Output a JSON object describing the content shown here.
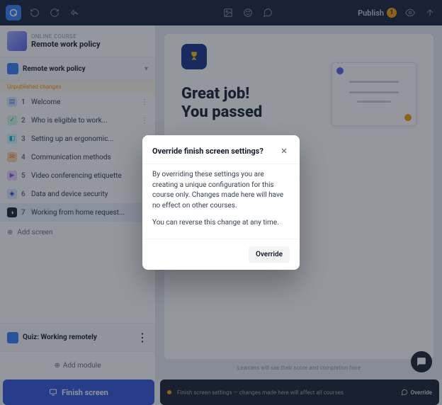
{
  "topbar": {
    "publish_label": "Publish",
    "publish_badge": "1"
  },
  "crumb": {
    "category": "ONLINE COURSE",
    "title": "Remote work policy"
  },
  "section": {
    "title": "Remote work policy",
    "unpublished_label": "Unpublished changes"
  },
  "items": [
    {
      "num": "1",
      "label": "Welcome"
    },
    {
      "num": "2",
      "label": "Who is eligible to work..."
    },
    {
      "num": "3",
      "label": "Setting up an ergonomic..."
    },
    {
      "num": "4",
      "label": "Communication methods"
    },
    {
      "num": "5",
      "label": "Video conferencing etiquette"
    },
    {
      "num": "6",
      "label": "Data and device security"
    },
    {
      "num": "7",
      "label": "Working from home request..."
    }
  ],
  "add_screen": "Add screen",
  "quiz": {
    "label": "Quiz: Working remotely"
  },
  "add_module": "Add module",
  "preview": {
    "line1": "Great job!",
    "line2": "You passed"
  },
  "footer_note": "Learners will see their score and completion here",
  "finish_button": "Finish screen",
  "settings_note": "Finish screen settings — changes made here will affect all courses",
  "override_link": "Override",
  "modal": {
    "title": "Override finish screen settings?",
    "p1": "By overriding these settings you are creating a unique configuration for this course only. Changes made here will have no effect on other courses.",
    "p2": "You can reverse this change at any time.",
    "button": "Override"
  }
}
